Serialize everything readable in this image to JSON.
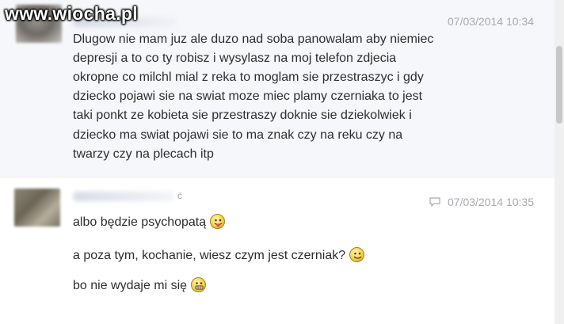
{
  "watermark": "www.wiocha.pl",
  "messages": [
    {
      "timestamp": "07/03/2014 10:34",
      "lines": [
        "Dlugow nie mam juz ale duzo nad soba panowalam aby niemiec",
        "depresji a to co ty robisz i wysylasz na moj telefon zdjecia",
        "okropne co milchl mial z reka to moglam sie przestraszyc i gdy",
        "dziecko pojawi sie na swiat moze miec plamy czerniaka to jest",
        "taki ponkt ze kobieta sie przestraszy doknie sie dziekolwiek i",
        "dziecko ma swiat pojawi sie to ma znak czy na reku  czy na",
        "twarzy czy na plecach itp"
      ]
    },
    {
      "timestamp": "07/03/2014 10:35",
      "name_mark": "ć",
      "lines": [
        "albo będzie psychopatą",
        "a poza tym, kochanie, wiesz czym jest czerniak?",
        "bo nie wydaje mi się"
      ],
      "emoji_icons": [
        "tongue-out-emoji-icon",
        "smiley-emoji-icon",
        "grin-emoji-icon"
      ]
    }
  ]
}
